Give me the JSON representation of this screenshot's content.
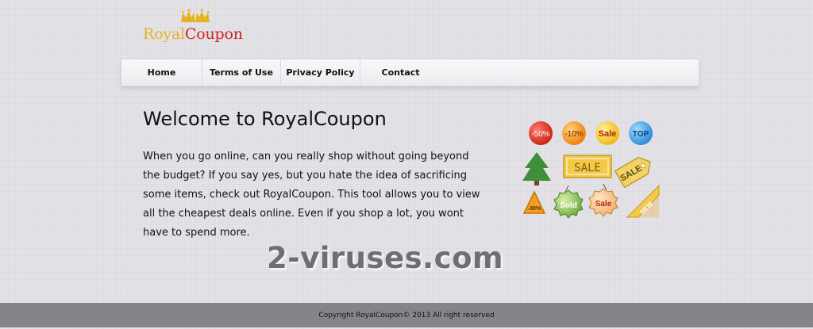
{
  "logo": {
    "part1": "Royal",
    "part2": "Coupon"
  },
  "nav": {
    "items": [
      {
        "label": "Home"
      },
      {
        "label": "Terms of Use"
      },
      {
        "label": "Privacy Policy"
      },
      {
        "label": "Contact"
      }
    ]
  },
  "main": {
    "title": "Welcome to RoyalCoupon",
    "text": "When you go online, can you really shop without going beyond the budget? If you say yes, but you hate the idea of sacrificing some items, check out RoyalCoupon. This tool allows you to view all the cheapest deals online. Even if you shop a lot, you wont have to spend more."
  },
  "tags": {
    "badge1": "-50%",
    "badge2": "-10%",
    "badge3": "Sale",
    "badge4": "TOP",
    "sign_sale": "SALE",
    "label_sale": "SALE",
    "triangle": "-30%",
    "sold": "Sold",
    "seal_sale": "Sale",
    "ribbon": "NEW"
  },
  "watermark": "2-viruses.com",
  "footer": {
    "copyright": "Copyright RoyalCoupon© 2013 All right reserved"
  },
  "colors": {
    "background": "#e6e4e9",
    "logo_royal": "#e6b422",
    "logo_coupon": "#cc2222",
    "footer_bg": "#858489"
  }
}
